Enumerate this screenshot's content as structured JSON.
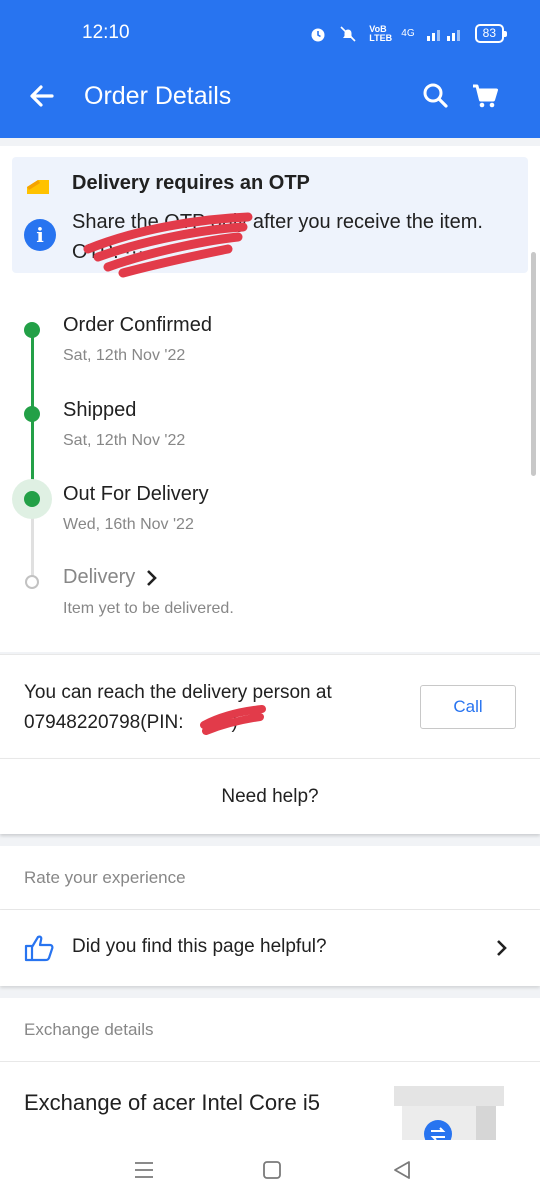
{
  "status_bar": {
    "time": "12:10",
    "network_label": "VoB LTEB",
    "network_type": "4G",
    "battery": "83"
  },
  "app_bar": {
    "title": "Order Details",
    "back_icon": "arrow-left-icon",
    "search_icon": "search-icon",
    "cart_icon": "cart-icon",
    "color": "#2874f0"
  },
  "otp_notice": {
    "title": "Delivery requires an OTP",
    "description": "Share the OTP only after you receive the item.",
    "line2": "OTP: ····",
    "tag_icon": "tag-icon",
    "info_icon": "info-icon"
  },
  "tracker": {
    "steps": [
      {
        "title": "Order Confirmed",
        "subtitle": "Sat, 12th Nov '22",
        "done": true
      },
      {
        "title": "Shipped",
        "subtitle": "Sat, 12th Nov '22",
        "done": true
      },
      {
        "title": "Out For Delivery",
        "subtitle": "Wed, 16th Nov '22",
        "done": true
      },
      {
        "title": "Delivery",
        "subtitle": "Item yet to be delivered.",
        "done": false
      }
    ],
    "done_color": "#23a047"
  },
  "contact": {
    "line1": "You can reach the delivery person at",
    "line2": "07948220798(PIN:",
    "line2_end": ")",
    "call_label": "Call"
  },
  "help": {
    "label": "Need help?"
  },
  "rating": {
    "header": "Rate your experience",
    "question": "Did you find this page helpful?",
    "thumb_icon": "thumbs-up-icon",
    "chevron_icon": "chevron-right-icon"
  },
  "exchange": {
    "header": "Exchange details",
    "title": "Exchange of acer Intel Core i5",
    "image_icon": "exchange-icon"
  },
  "nav": {
    "recent_icon": "menu-icon",
    "home_icon": "square-icon",
    "back_icon": "triangle-back-icon"
  }
}
